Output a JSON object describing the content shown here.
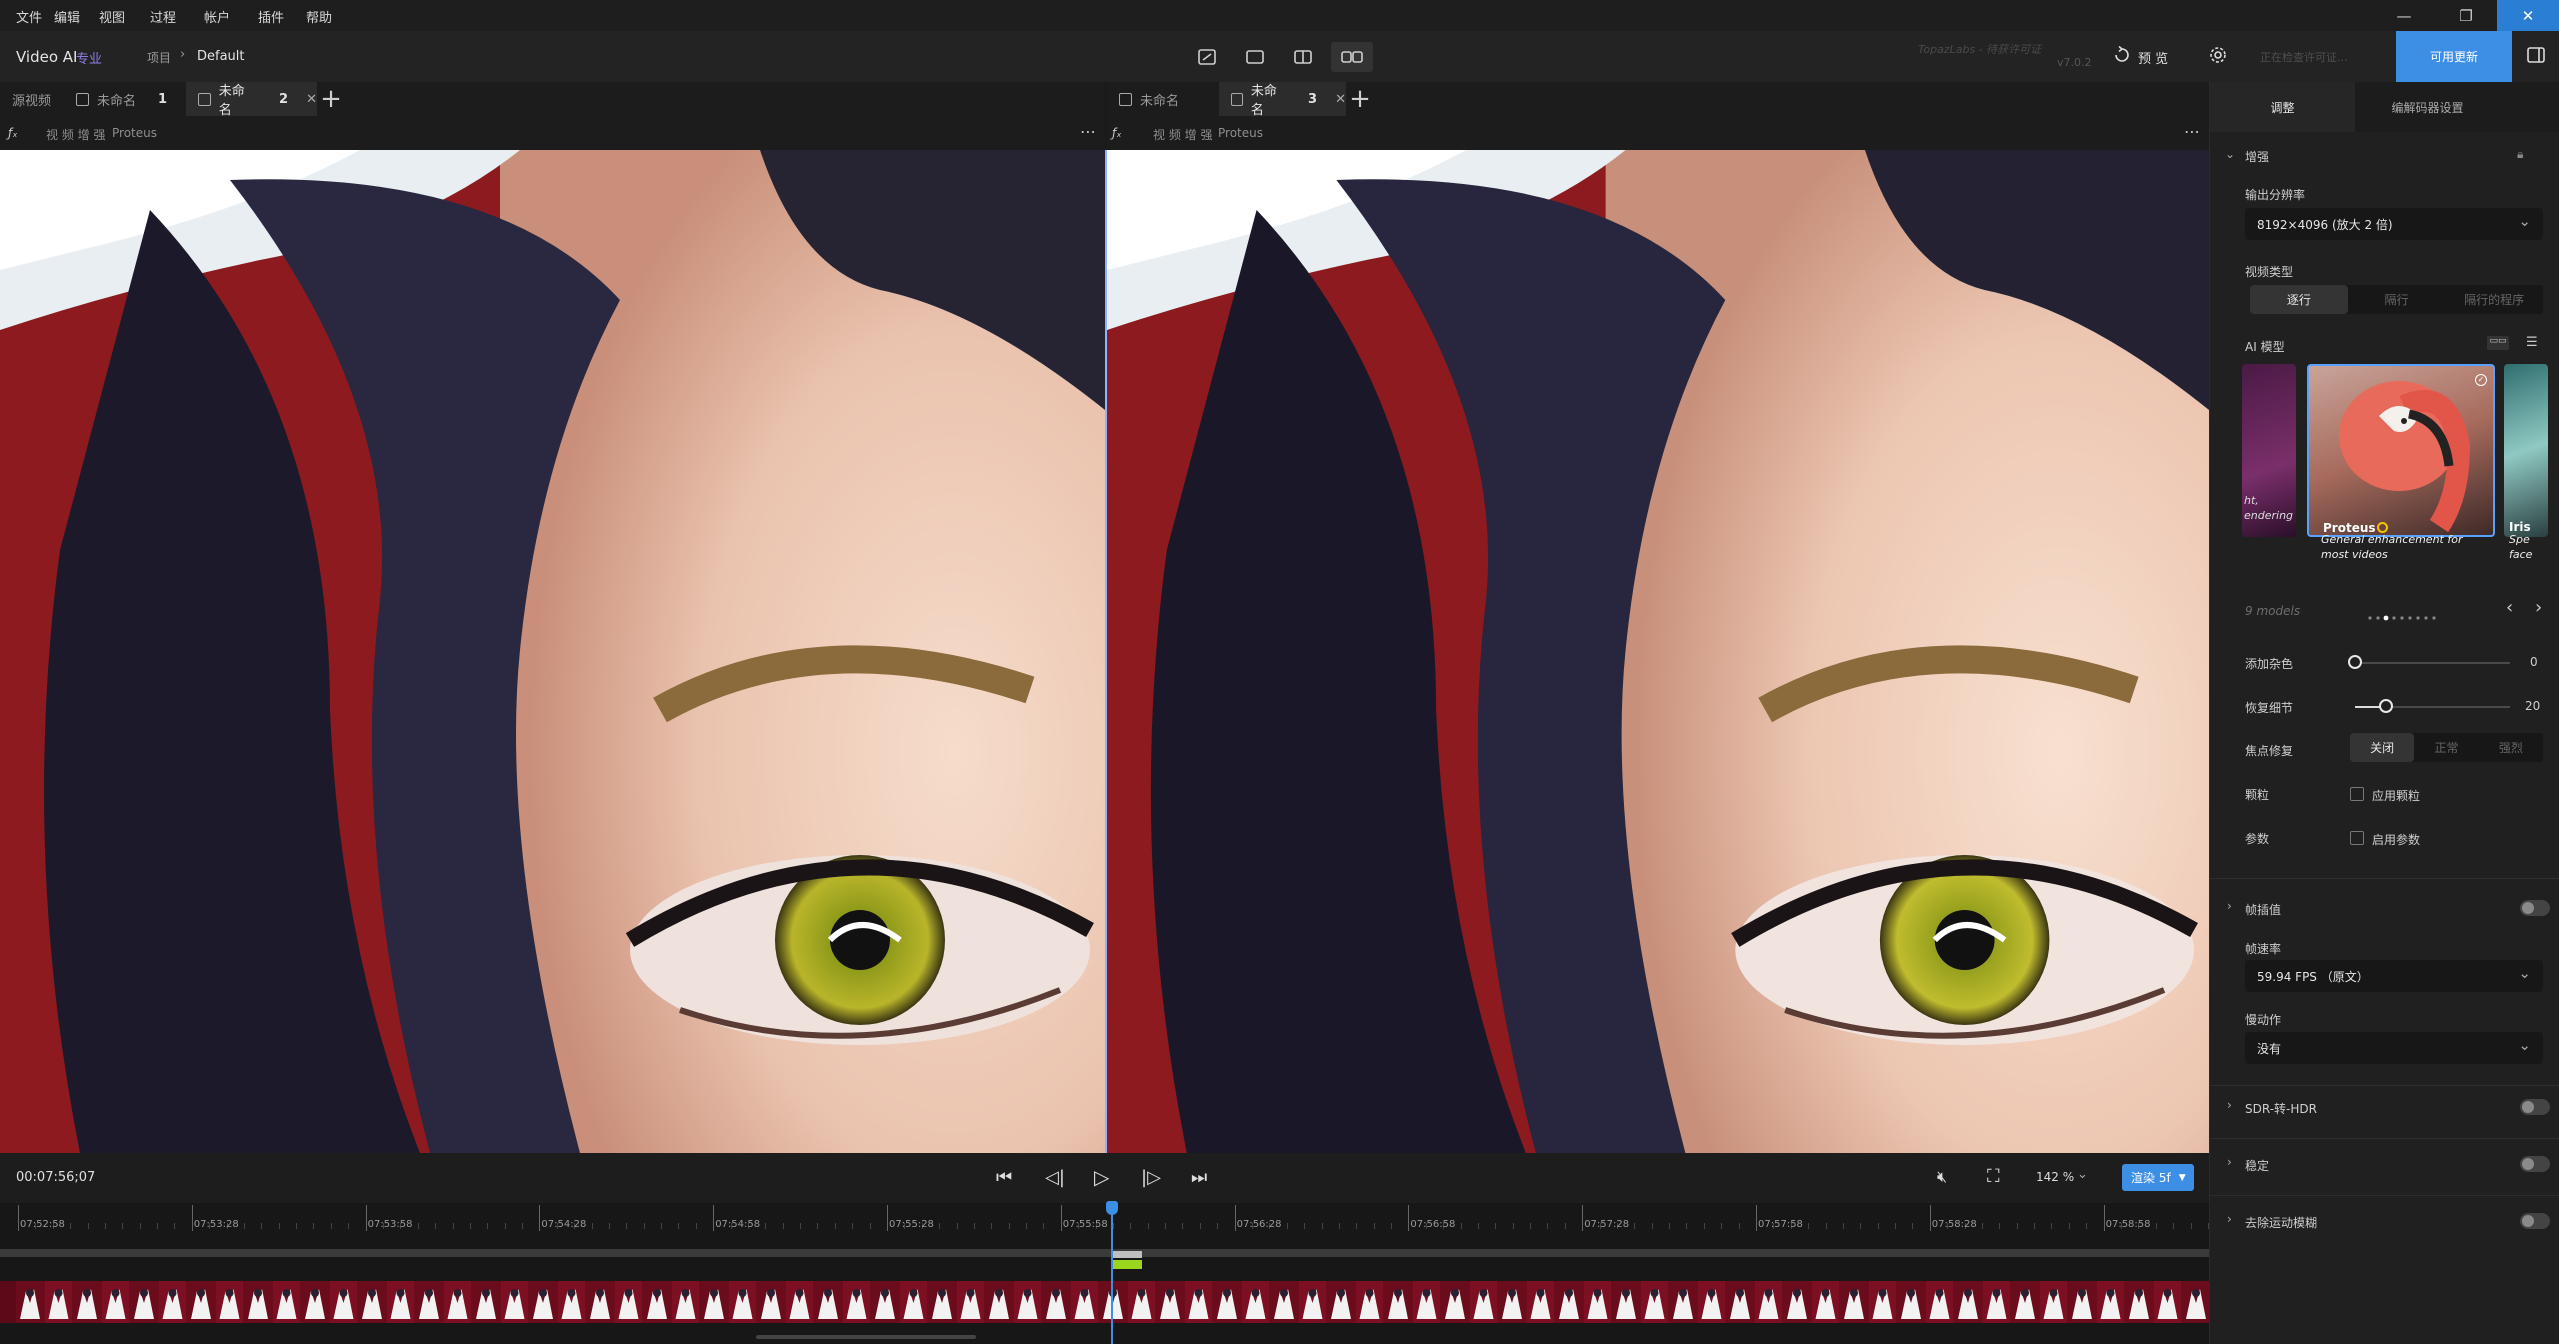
{
  "menu": [
    "文件",
    "编辑",
    "视图",
    "过程",
    "帐户",
    "插件",
    "帮助"
  ],
  "app": {
    "name": "Video AI",
    "edition": "专业",
    "breadcrumb_root": "项目",
    "breadcrumb_current": "Default",
    "watermark_line": "TopazLabs - 待获许可证",
    "version": "v7.0.2",
    "preview_label": "预 览",
    "license_placeholder": "正在检查许可证...",
    "update_button": "可用更新"
  },
  "left_tabs": [
    {
      "label": "源视频",
      "num": "",
      "active": false
    },
    {
      "label": "未命名",
      "num": "1",
      "active": false
    },
    {
      "label": "未命名",
      "num": "2",
      "active": true
    }
  ],
  "right_tabs": [
    {
      "label": "未命名",
      "num": "",
      "active": false
    },
    {
      "label": "未命名",
      "num": "3",
      "active": true
    }
  ],
  "left_sub": {
    "label": "视 频 增 强",
    "model": "Proteus"
  },
  "right_sub": {
    "label": "视 频 增 强",
    "model": "Proteus"
  },
  "playback": {
    "timecode": "00:07:56;07",
    "zoom": "142 %",
    "render_button": "渲染 5f"
  },
  "timeline": {
    "ticks": [
      "07:52:58",
      "07:53:28",
      "07:53:58",
      "07:54:28",
      "07:54:58",
      "07:55:28",
      "07:55:58",
      "07:56:28",
      "07:56:58",
      "07:57:28",
      "07:57:58",
      "07:58:28",
      "07:58:58"
    ],
    "playhead": 0.5
  },
  "panel": {
    "tab_adjust": "调整",
    "tab_encoder": "编解码器设置",
    "section_enhance": "增强",
    "output_res_label": "输出分辨率",
    "output_res_value": "8192×4096 (放大 2 倍)",
    "video_type_label": "视频类型",
    "video_type_options": [
      "逐行",
      "隔行",
      "隔行的程序"
    ],
    "video_type_selected": 0,
    "ai_model_label": "AI 模型",
    "left_card_text": [
      "ht,",
      "endering"
    ],
    "card_name": "Proteus",
    "card_desc_1": "General enhancement for",
    "card_desc_2": "most videos",
    "right_card_name": "Iris",
    "right_card_desc": [
      "Spe",
      "face"
    ],
    "models_count": "9 models",
    "add_noise_label": "添加杂色",
    "add_noise_value": "0",
    "add_noise_frac": 0,
    "recover_label": "恢复细节",
    "recover_value": "20",
    "recover_frac": 0.2,
    "focus_label": "焦点修复",
    "focus_options": [
      "关闭",
      "正常",
      "强烈"
    ],
    "focus_selected": 0,
    "grain_label": "颗粒",
    "grain_check": "应用颗粒",
    "params_label": "参数",
    "params_check": "启用参数",
    "section_frame_interp": "帧插值",
    "fps_label": "帧速率",
    "fps_value": "59.94 FPS （原文）",
    "slowmo_label": "慢动作",
    "slowmo_value": "没有",
    "section_sdr": "SDR-转-HDR",
    "section_stabilize": "稳定",
    "section_deblur": "去除运动模糊"
  }
}
